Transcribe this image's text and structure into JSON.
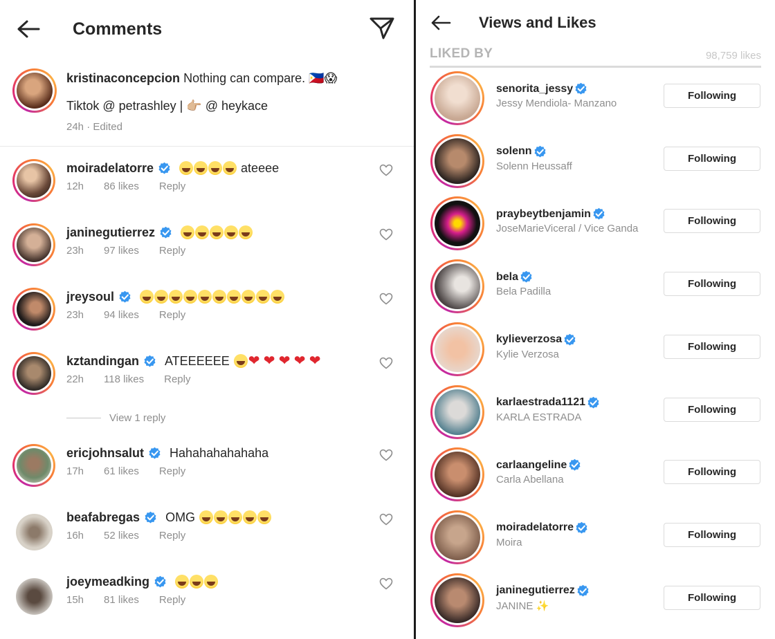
{
  "left": {
    "title": "Comments",
    "caption": {
      "username": "kristinaconcepcion",
      "text": "Nothing can compare. 🇵🇭😱",
      "line2": "Tiktok @ petrashley | 👉🏼 @ heykace",
      "time": "24h",
      "edited": "Edited"
    },
    "comments": [
      {
        "username": "moiradelatorre",
        "text": "ateeee",
        "emoji_before": 4,
        "hearts": 0,
        "time": "12h",
        "likes": "86 likes",
        "reply": "Reply"
      },
      {
        "username": "janinegutierrez",
        "text": "",
        "emoji_before": 5,
        "hearts": 0,
        "time": "23h",
        "likes": "97 likes",
        "reply": "Reply"
      },
      {
        "username": "jreysoul",
        "text": "",
        "emoji_before": 10,
        "hearts": 0,
        "time": "23h",
        "likes": "94 likes",
        "reply": "Reply"
      },
      {
        "username": "kztandingan",
        "text": "ATEEEEEE",
        "emoji_before": 0,
        "emoji_after": 1,
        "hearts": 5,
        "time": "22h",
        "likes": "118 likes",
        "reply": "Reply"
      },
      {
        "username": "ericjohnsalut",
        "text": "Hahahahahahaha",
        "emoji_before": 0,
        "hearts": 0,
        "time": "17h",
        "likes": "61 likes",
        "reply": "Reply"
      },
      {
        "username": "beafabregas",
        "text": "OMG",
        "emoji_before": 0,
        "emoji_after": 5,
        "hearts": 0,
        "time": "16h",
        "likes": "52 likes",
        "reply": "Reply"
      },
      {
        "username": "joeymeadking",
        "text": "",
        "emoji_before": 3,
        "hearts": 0,
        "time": "15h",
        "likes": "81 likes",
        "reply": "Reply"
      }
    ],
    "view_replies": "View 1 reply"
  },
  "right": {
    "title": "Views and Likes",
    "liked_by_label": "LIKED BY",
    "likes_count": "98,759 likes",
    "likers": [
      {
        "username": "senorita_jessy",
        "name": "Jessy Mendiola- Manzano",
        "button": "Following"
      },
      {
        "username": "solenn",
        "name": "Solenn Heussaff",
        "button": "Following"
      },
      {
        "username": "praybeytbenjamin",
        "name": "JoseMarieViceral / Vice Ganda",
        "button": "Following"
      },
      {
        "username": "bela",
        "name": "Bela Padilla",
        "button": "Following"
      },
      {
        "username": "kylieverzosa",
        "name": "Kylie Verzosa",
        "button": "Following"
      },
      {
        "username": "karlaestrada1121",
        "name": "KARLA ESTRADA",
        "button": "Following"
      },
      {
        "username": "carlaangeline",
        "name": "Carla Abellana",
        "button": "Following"
      },
      {
        "username": "moiradelatorre",
        "name": "Moira",
        "button": "Following"
      },
      {
        "username": "janinegutierrez",
        "name": "JANINE ✨",
        "button": "Following"
      }
    ]
  },
  "colors": {
    "verified": "#3897f0",
    "text": "#262626",
    "muted": "#8e8e8e",
    "divider": "#1a1a1a"
  }
}
